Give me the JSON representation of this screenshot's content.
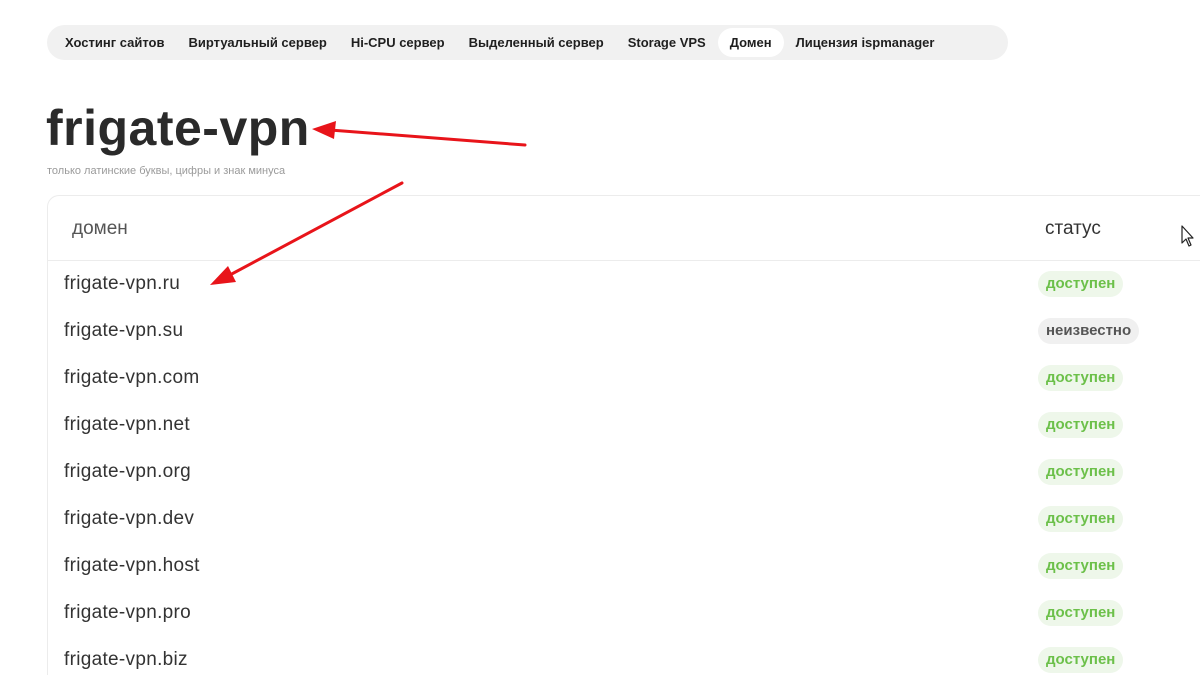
{
  "nav": {
    "tabs": [
      {
        "label": "Хостинг сайтов",
        "active": false
      },
      {
        "label": "Виртуальный сервер",
        "active": false
      },
      {
        "label": "Hi-CPU сервер",
        "active": false
      },
      {
        "label": "Выделенный сервер",
        "active": false
      },
      {
        "label": "Storage VPS",
        "active": false
      },
      {
        "label": "Домен",
        "active": true
      },
      {
        "label": "Лицензия ispmanager",
        "active": false
      }
    ]
  },
  "search": {
    "value": "frigate-vpn",
    "hint": "только латинские буквы, цифры и знак минуса"
  },
  "results": {
    "col_domain": "домен",
    "col_status": "статус",
    "rows": [
      {
        "domain": "frigate-vpn.ru",
        "status": "доступен",
        "state": "available"
      },
      {
        "domain": "frigate-vpn.su",
        "status": "неизвестно",
        "state": "unknown"
      },
      {
        "domain": "frigate-vpn.com",
        "status": "доступен",
        "state": "available"
      },
      {
        "domain": "frigate-vpn.net",
        "status": "доступен",
        "state": "available"
      },
      {
        "domain": "frigate-vpn.org",
        "status": "доступен",
        "state": "available"
      },
      {
        "domain": "frigate-vpn.dev",
        "status": "доступен",
        "state": "available"
      },
      {
        "domain": "frigate-vpn.host",
        "status": "доступен",
        "state": "available"
      },
      {
        "domain": "frigate-vpn.pro",
        "status": "доступен",
        "state": "available"
      },
      {
        "domain": "frigate-vpn.biz",
        "status": "доступен",
        "state": "available"
      }
    ]
  },
  "colors": {
    "available_text": "#6cc04a",
    "available_bg": "#eef7ea",
    "unknown_bg": "#f0f0f0",
    "annotation_arrow": "#e8141a"
  },
  "icons": {
    "cursor": "mouse-pointer-icon",
    "annotation": "red-arrow-annotation"
  }
}
